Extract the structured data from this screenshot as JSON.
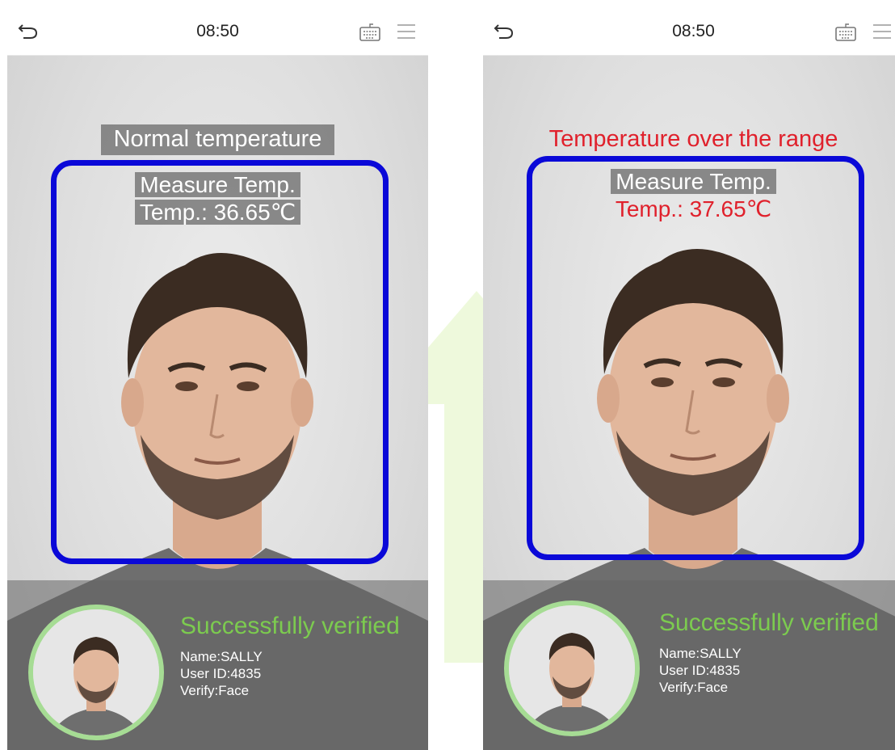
{
  "screens": [
    {
      "clock": "08:50",
      "status_text": "Normal temperature",
      "measure_label": "Measure Temp.",
      "temp_text": "Temp.: 36.65℃",
      "verified_text": "Successfully verified",
      "name_text": "Name:SALLY",
      "user_id_text": "User ID:4835",
      "verify_text": "Verify:Face"
    },
    {
      "clock": "08:50",
      "status_text": "Temperature over the range",
      "measure_label": "Measure Temp.",
      "temp_text": "Temp.: 37.65℃",
      "verified_text": "Successfully verified",
      "name_text": "Name:SALLY",
      "user_id_text": "User ID:4835",
      "verify_text": "Verify:Face"
    }
  ],
  "colors": {
    "frame": "#0a08d8",
    "alert_red": "#e0212c",
    "verified_green": "#7ccb4f",
    "avatar_ring": "#a6dc94"
  },
  "icons": [
    "back-arrow-icon",
    "keyboard-icon",
    "menu-icon"
  ]
}
